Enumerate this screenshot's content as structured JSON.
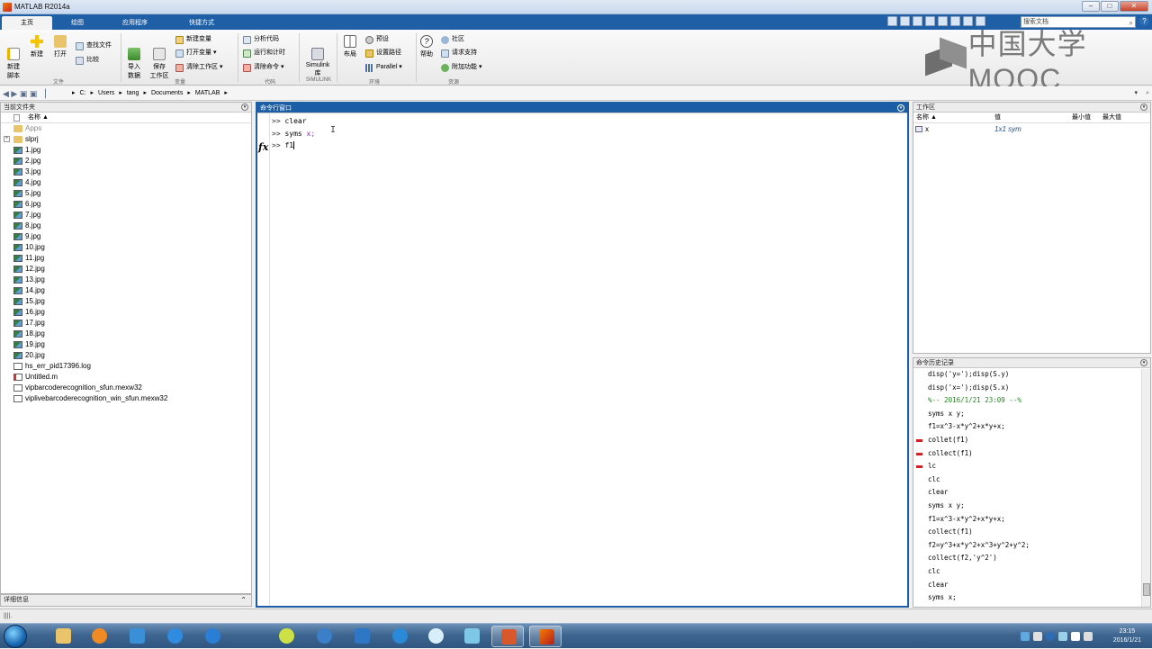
{
  "window": {
    "title": "MATLAB R2014a"
  },
  "tabs": [
    "主页",
    "绘图",
    "应用程序",
    "快捷方式"
  ],
  "search": {
    "placeholder": "搜索文档"
  },
  "ribbon": {
    "new_script": "新建\n脚本",
    "new": "新建",
    "open": "打开",
    "find_files": "查找文件",
    "compare": "比较",
    "import_data": "导入\n数据",
    "save_workspace": "保存\n工作区",
    "new_variable": "新建变量",
    "open_variable": "打开变量",
    "clear_workspace": "清除工作区",
    "analyze_code": "分析代码",
    "run_and_time": "运行和计时",
    "clear_commands": "清除命令",
    "simulink": "Simulink\n库",
    "layout": "布局",
    "preferences": "预设",
    "set_path": "设置路径",
    "parallel": "Parallel",
    "help": "帮助",
    "community": "社区",
    "request_support": "请求支持",
    "addons": "附加功能",
    "groups": [
      "文件",
      "变量",
      "代码",
      "SIMULINK",
      "环境",
      "资源"
    ]
  },
  "watermark": {
    "text": "中国大学MOOC"
  },
  "address": {
    "segments": [
      "C:",
      "Users",
      "tang",
      "Documents",
      "MATLAB"
    ]
  },
  "file_browser": {
    "title": "当前文件夹",
    "column_name": "名称 ▲",
    "items": [
      {
        "name": "Apps",
        "kind": "folder",
        "dim": true
      },
      {
        "name": "slprj",
        "kind": "folder",
        "expand": true
      },
      {
        "name": "1.jpg",
        "kind": "img"
      },
      {
        "name": "2.jpg",
        "kind": "img"
      },
      {
        "name": "3.jpg",
        "kind": "img"
      },
      {
        "name": "4.jpg",
        "kind": "img"
      },
      {
        "name": "5.jpg",
        "kind": "img"
      },
      {
        "name": "6.jpg",
        "kind": "img"
      },
      {
        "name": "7.jpg",
        "kind": "img"
      },
      {
        "name": "8.jpg",
        "kind": "img"
      },
      {
        "name": "9.jpg",
        "kind": "img"
      },
      {
        "name": "10.jpg",
        "kind": "img"
      },
      {
        "name": "11.jpg",
        "kind": "img"
      },
      {
        "name": "12.jpg",
        "kind": "img"
      },
      {
        "name": "13.jpg",
        "kind": "img"
      },
      {
        "name": "14.jpg",
        "kind": "img"
      },
      {
        "name": "15.jpg",
        "kind": "img"
      },
      {
        "name": "16.jpg",
        "kind": "img"
      },
      {
        "name": "17.jpg",
        "kind": "img"
      },
      {
        "name": "18.jpg",
        "kind": "img"
      },
      {
        "name": "19.jpg",
        "kind": "img"
      },
      {
        "name": "20.jpg",
        "kind": "img"
      },
      {
        "name": "hs_err_pid17396.log",
        "kind": "doc"
      },
      {
        "name": "Untitled.m",
        "kind": "m"
      },
      {
        "name": "vipbarcoderecognition_sfun.mexw32",
        "kind": "mex"
      },
      {
        "name": "viplivebarcoderecognition_win_sfun.mexw32",
        "kind": "mex"
      }
    ],
    "details": "详细信息"
  },
  "command_window": {
    "title": "命令行窗口",
    "prompt": ">>",
    "lines": [
      {
        "cmd": "clear",
        "arg": ""
      },
      {
        "cmd": "syms",
        "arg": " x;"
      },
      {
        "cmd": "f1",
        "arg": ""
      }
    ],
    "fx": "fx"
  },
  "workspace": {
    "title": "工作区",
    "columns": [
      "名称 ▲",
      "值",
      "最小值",
      "最大值"
    ],
    "rows": [
      {
        "name": "x",
        "value": "1x1 sym"
      }
    ]
  },
  "history": {
    "title": "命令历史记录",
    "lines": [
      {
        "text": "disp('y=');disp(S.y)"
      },
      {
        "text": "disp('x=');disp(S.x)"
      },
      {
        "text": "%-- 2016/1/21 23:09 --%",
        "comment": true
      },
      {
        "text": "syms x y;"
      },
      {
        "text": "f1=x^3-x*y^2+x*y+x;"
      },
      {
        "text": "collet(f1)",
        "error": true
      },
      {
        "text": "collect(f1)",
        "error": true
      },
      {
        "text": "lc",
        "error": true
      },
      {
        "text": "clc"
      },
      {
        "text": "clear"
      },
      {
        "text": "syms x y;"
      },
      {
        "text": "f1=x^3-x*y^2+x*y+x;"
      },
      {
        "text": "collect(f1)"
      },
      {
        "text": "f2=y^3+x*y^2+x^3+y^2+y^2;"
      },
      {
        "text": "collect(f2,'y^2')"
      },
      {
        "text": "clc"
      },
      {
        "text": "clear"
      },
      {
        "text": "syms x;"
      }
    ]
  },
  "taskbar": {
    "time": "23:15",
    "date": "2016/1/21"
  },
  "colors": {
    "accent": "#1c5ea5",
    "tab_strip": "#1f5fa6",
    "error_mark": "#d32020",
    "comment": "#1f8a1f",
    "string": "#a020f0"
  }
}
